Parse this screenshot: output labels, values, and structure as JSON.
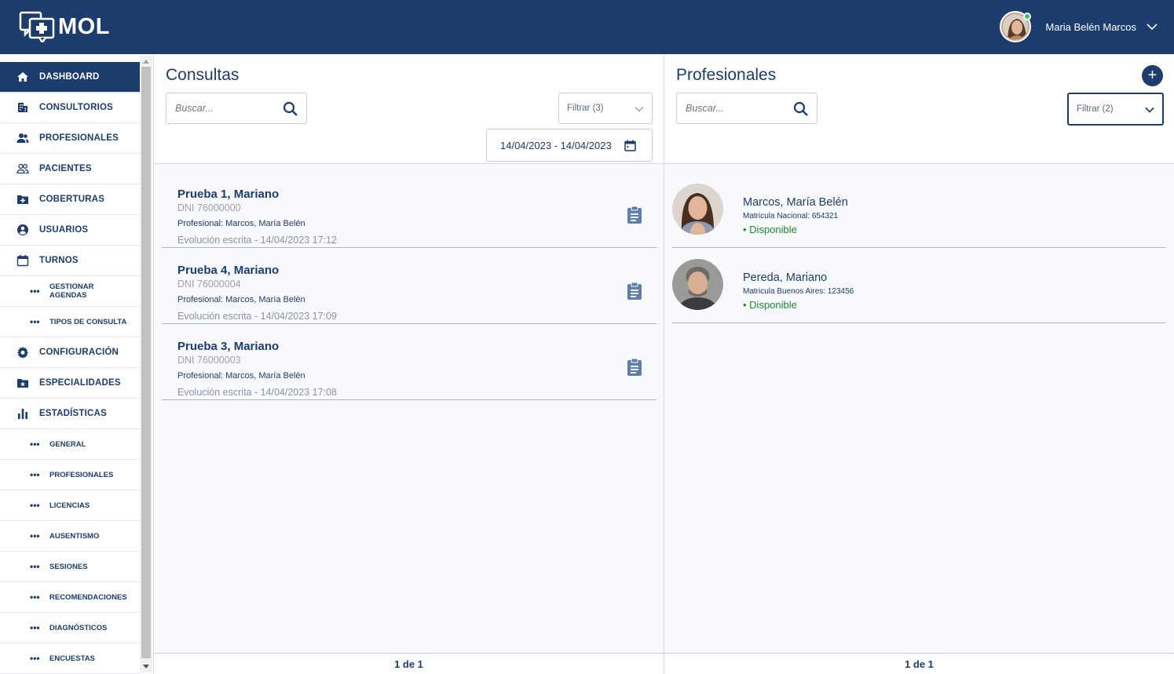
{
  "header": {
    "logo_text": "MOL",
    "user_name": "Maria Belén Marcos",
    "colors": {
      "bar": "#1d3c6e",
      "online": "#3bc55a"
    }
  },
  "sidebar": {
    "items": [
      {
        "label": "DASHBOARD",
        "icon": "home-icon",
        "active": true
      },
      {
        "label": "CONSULTORIOS",
        "icon": "building-icon"
      },
      {
        "label": "PROFESIONALES",
        "icon": "people-icon"
      },
      {
        "label": "PACIENTES",
        "icon": "people-outline-icon"
      },
      {
        "label": "COBERTURAS",
        "icon": "folder-plus-icon"
      },
      {
        "label": "USUARIOS",
        "icon": "user-circle-icon"
      },
      {
        "label": "TURNOS",
        "icon": "calendar-icon"
      },
      {
        "label": "GESTIONAR AGENDAS",
        "sub": true
      },
      {
        "label": "TIPOS DE CONSULTA",
        "sub": true
      },
      {
        "label": "CONFIGURACIÓN",
        "icon": "gear-icon"
      },
      {
        "label": "ESPECIALIDADES",
        "icon": "folder-star-icon"
      },
      {
        "label": "ESTADÍSTICAS",
        "icon": "bar-chart-icon"
      },
      {
        "label": "GENERAL",
        "sub": true
      },
      {
        "label": "PROFESIONALES",
        "sub": true
      },
      {
        "label": "LICENCIAS",
        "sub": true
      },
      {
        "label": "AUSENTISMO",
        "sub": true
      },
      {
        "label": "SESIONES",
        "sub": true
      },
      {
        "label": "RECOMENDACIONES",
        "sub": true
      },
      {
        "label": "DIAGNÓSTICOS",
        "sub": true
      },
      {
        "label": "ENCUESTAS",
        "sub": true
      }
    ],
    "sub_bullet": "•••"
  },
  "consultas": {
    "title": "Consultas",
    "search_placeholder": "Buscar...",
    "filter_label": "Filtrar (3)",
    "date_range": "14/04/2023 - 14/04/2023",
    "items": [
      {
        "name": "Prueba 1, Mariano",
        "dni": "DNI 76000000",
        "profesional": "Profesional: Marcos, María Belén",
        "evolucion": "Evolución escrita - 14/04/2023 17:12"
      },
      {
        "name": "Prueba 4, Mariano",
        "dni": "DNI 76000004",
        "profesional": "Profesional: Marcos, María Belén",
        "evolucion": "Evolución escrita - 14/04/2023 17:09"
      },
      {
        "name": "Prueba 3, Mariano",
        "dni": "DNI 76000003",
        "profesional": "Profesional: Marcos, María Belén",
        "evolucion": "Evolución escrita - 14/04/2023 17:08"
      }
    ],
    "pager": "1 de 1"
  },
  "profesionales": {
    "title": "Profesionales",
    "add_label": "+",
    "search_placeholder": "Buscar...",
    "filter_label": "Filtrar (2)",
    "items": [
      {
        "name": "Marcos, María Belén",
        "matricula": "Matricula Nacional: 654321",
        "status": "• Disponible"
      },
      {
        "name": "Pereda, Mariano",
        "matricula": "Matricula Buenos Aires: 123456",
        "status": "• Disponible"
      }
    ],
    "pager": "1 de 1"
  }
}
